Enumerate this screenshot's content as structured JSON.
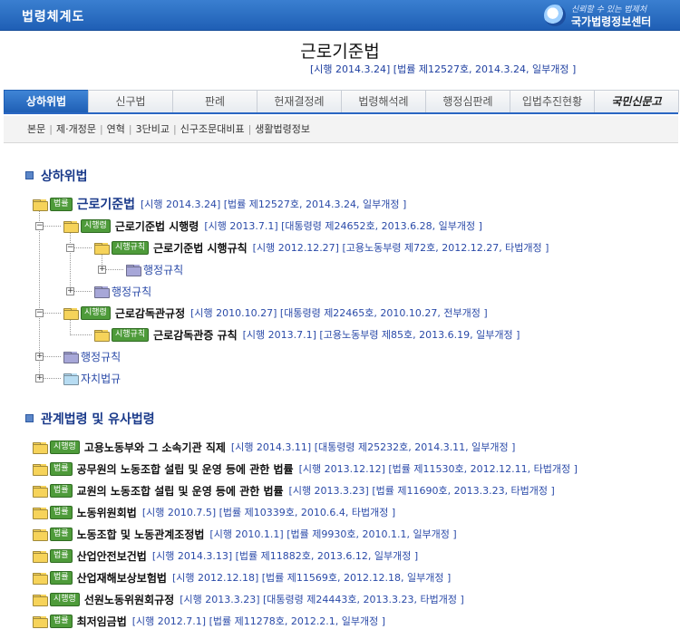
{
  "header": {
    "title": "법령체계도",
    "brand_tagline": "신뢰할 수 있는 법제처",
    "brand_name": "국가법령정보센터"
  },
  "law": {
    "name": "근로기준법",
    "meta": "[시행 2014.3.24] [법률 제12527호, 2014.3.24, 일부개정 ]"
  },
  "tabs": [
    {
      "label": "상하위법"
    },
    {
      "label": "신구법"
    },
    {
      "label": "판례"
    },
    {
      "label": "헌재결정례"
    },
    {
      "label": "법령해석례"
    },
    {
      "label": "행정심판례"
    },
    {
      "label": "입법추진현황"
    },
    {
      "label": "국민신문고"
    }
  ],
  "subnav": [
    "본문",
    "제·개정문",
    "연혁",
    "3단비교",
    "신구조문대비표",
    "생활법령정보"
  ],
  "sections": {
    "hierarchy": "상하위법",
    "related": "관계법령 및 유사법령"
  },
  "tree": [
    {
      "badge": "법률",
      "name": "근로기준법",
      "meta": "[시행 2014.3.24] [법률 제12527호, 2014.3.24, 일부개정 ]"
    },
    {
      "badge": "시행령",
      "name": "근로기준법 시행령",
      "meta": "[시행 2013.7.1] [대통령령 제24652호, 2013.6.28, 일부개정 ]"
    },
    {
      "badge": "시행규칙",
      "name": "근로기준법 시행규칙",
      "meta": "[시행 2012.12.27] [고용노동부령 제72호, 2012.12.27, 타법개정 ]"
    },
    {
      "name": "행정규칙"
    },
    {
      "name": "행정규칙"
    },
    {
      "badge": "시행령",
      "name": "근로감독관규정",
      "meta": "[시행 2010.10.27] [대통령령 제22465호, 2010.10.27, 전부개정 ]"
    },
    {
      "badge": "시행규칙",
      "name": "근로감독관증 규칙",
      "meta": "[시행 2013.7.1] [고용노동부령 제85호, 2013.6.19, 일부개정 ]"
    },
    {
      "name": "행정규칙"
    },
    {
      "name": "자치법규"
    }
  ],
  "related": [
    {
      "badge": "시행령",
      "name": "고용노동부와 그 소속기관 직제",
      "meta": "[시행 2014.3.11] [대통령령 제25232호, 2014.3.11, 일부개정 ]"
    },
    {
      "badge": "법률",
      "name": "공무원의 노동조합 설립 및 운영 등에 관한 법률",
      "meta": "[시행 2013.12.12] [법률 제11530호, 2012.12.11, 타법개정 ]"
    },
    {
      "badge": "법률",
      "name": "교원의 노동조합 설립 및 운영 등에 관한 법률",
      "meta": "[시행 2013.3.23] [법률 제11690호, 2013.3.23, 타법개정 ]"
    },
    {
      "badge": "법률",
      "name": "노동위원회법",
      "meta": "[시행 2010.7.5] [법률 제10339호, 2010.6.4, 타법개정 ]"
    },
    {
      "badge": "법률",
      "name": "노동조합 및 노동관계조정법",
      "meta": "[시행 2010.1.1] [법률 제9930호, 2010.1.1, 일부개정 ]"
    },
    {
      "badge": "법률",
      "name": "산업안전보건법",
      "meta": "[시행 2014.3.13] [법률 제11882호, 2013.6.12, 일부개정 ]"
    },
    {
      "badge": "법률",
      "name": "산업재해보상보험법",
      "meta": "[시행 2012.12.18] [법률 제11569호, 2012.12.18, 일부개정 ]"
    },
    {
      "badge": "시행령",
      "name": "선원노동위원회규정",
      "meta": "[시행 2013.3.23] [대통령령 제24443호, 2013.3.23, 타법개정 ]"
    },
    {
      "badge": "법률",
      "name": "최저임금법",
      "meta": "[시행 2012.7.1] [법률 제11278호, 2012.2.1, 일부개정 ]"
    }
  ],
  "colors": {
    "header_blue": "#1f5fb5",
    "badge_green": "#4e9b3a",
    "meta_blue": "#2a4aa8"
  }
}
